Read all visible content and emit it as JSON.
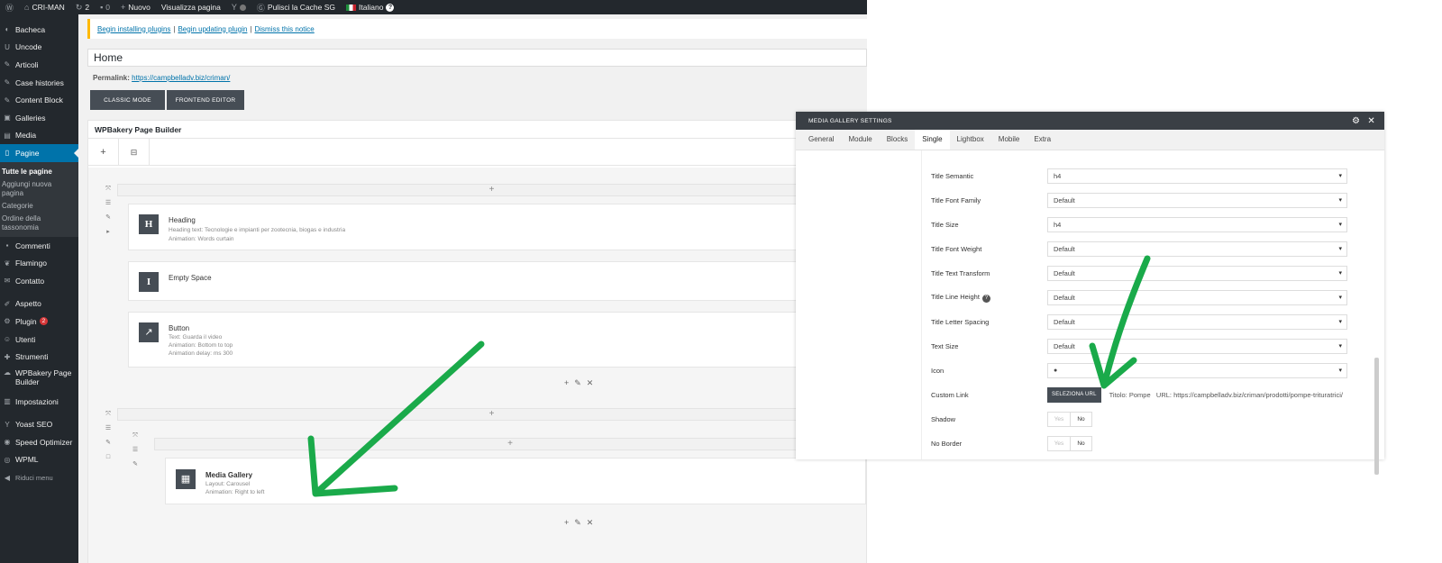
{
  "adminbar": {
    "site_name": "CRI-MAN",
    "updates": "2",
    "comments": "0",
    "new": "Nuovo",
    "view_page": "Visualizza pagina",
    "cache": "Pulisci la Cache SG",
    "language": "Italiano"
  },
  "sidebar": {
    "items": [
      {
        "label": "Bacheca",
        "icon": "dashboard-icon"
      },
      {
        "label": "Uncode",
        "icon": "uncode-icon"
      },
      {
        "label": "Articoli",
        "icon": "pin-icon"
      },
      {
        "label": "Case histories",
        "icon": "pin-icon"
      },
      {
        "label": "Content Block",
        "icon": "pin-icon"
      },
      {
        "label": "Galleries",
        "icon": "galleries-icon"
      },
      {
        "label": "Media",
        "icon": "media-icon"
      },
      {
        "label": "Pagine",
        "icon": "pages-icon"
      }
    ],
    "submenu": [
      "Tutte le pagine",
      "Aggiungi nuova pagina",
      "Categorie",
      "Ordine della tassonomia"
    ],
    "items2": [
      {
        "label": "Commenti"
      },
      {
        "label": "Flamingo"
      },
      {
        "label": "Contatto"
      },
      {
        "label": "Aspetto"
      },
      {
        "label": "Plugin",
        "badge": "2"
      },
      {
        "label": "Utenti"
      },
      {
        "label": "Strumenti"
      },
      {
        "label": "WPBakery Page Builder"
      },
      {
        "label": "Impostazioni"
      },
      {
        "label": "Yoast SEO"
      },
      {
        "label": "Speed Optimizer"
      },
      {
        "label": "WPML"
      },
      {
        "label": "Riduci menu"
      }
    ]
  },
  "notice": {
    "link1": "Begin installing plugins",
    "link2": "Begin updating plugin",
    "link3": "Dismiss this notice"
  },
  "page": {
    "title": "Home",
    "permalink_label": "Permalink:",
    "permalink_url": "https://campbelladv.biz/criman/",
    "classic_mode": "CLASSIC MODE",
    "frontend_editor": "FRONTEND EDITOR"
  },
  "builder": {
    "title": "WPBakery Page Builder",
    "elements": [
      {
        "name": "Heading",
        "icon": "H",
        "lines": [
          "Heading text: Tecnologie e impianti per zootecnia, biogas e industria",
          "Animation: Words curtain"
        ]
      },
      {
        "name": "Empty Space",
        "icon": "I",
        "lines": []
      },
      {
        "name": "Button",
        "icon": "↗",
        "lines": [
          "Text: Guarda il video",
          "Animation: Bottom to top",
          "Animation delay: ms 300"
        ]
      },
      {
        "name": "Media Gallery",
        "icon": "▦",
        "lines": [
          "Layout: Carousel",
          "Animation: Right to left"
        ]
      }
    ]
  },
  "modal": {
    "title": "MEDIA GALLERY SETTINGS",
    "tabs": [
      "General",
      "Module",
      "Blocks",
      "Single",
      "Lightbox",
      "Mobile",
      "Extra"
    ],
    "active_tab": "Single",
    "fields": [
      {
        "label": "Title Semantic",
        "value": "h4"
      },
      {
        "label": "Title Font Family",
        "value": "Default"
      },
      {
        "label": "Title Size",
        "value": "h4"
      },
      {
        "label": "Title Font Weight",
        "value": "Default"
      },
      {
        "label": "Title Text Transform",
        "value": "Default"
      },
      {
        "label": "Title Line Height",
        "value": "Default"
      },
      {
        "label": "Title Letter Spacing",
        "value": "Default"
      },
      {
        "label": "Text Size",
        "value": "Default"
      },
      {
        "label": "Icon",
        "value": ""
      }
    ],
    "custom_link_label": "Custom Link",
    "select_url": "SELEZIONA URL",
    "link_title_label": "Titolo:",
    "link_title": "Pompe",
    "link_url_label": "URL:",
    "link_url": "https://campbelladv.biz/criman/prodotti/pompe-trituratrici/",
    "shadow_label": "Shadow",
    "no_border_label": "No Border",
    "yes": "Yes",
    "no": "No"
  },
  "colors": {
    "admin_dark": "#23282d",
    "accent_blue": "#0073aa",
    "arrow_green": "#1aaa4a"
  }
}
